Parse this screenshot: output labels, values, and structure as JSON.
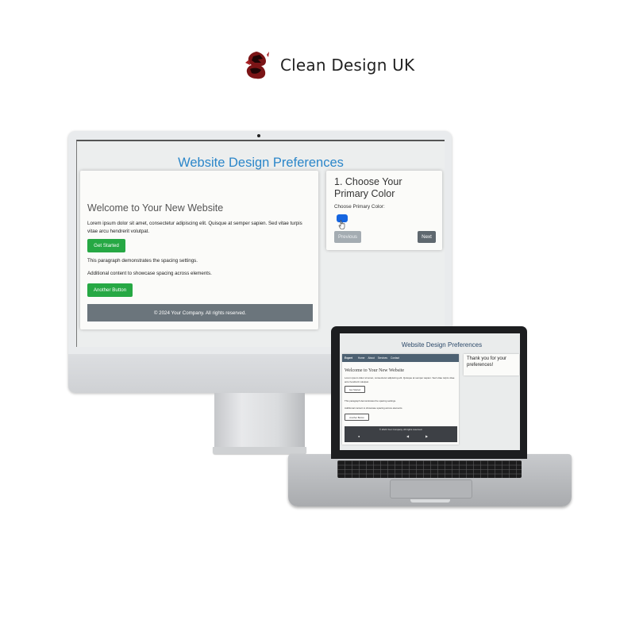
{
  "brand": {
    "name": "Clean Design UK",
    "logo_icon": "dragon-icon",
    "logo_color": "#7b1416"
  },
  "desktop": {
    "page_title": "Website Design Preferences",
    "title_color": "#2b86c9",
    "content": {
      "heading": "Welcome to Your New Website",
      "intro": "Lorem ipsum dolor sit amet, consectetur adipiscing elit. Quisque at semper sapien. Sed vitae turpis vitae arcu hendrerit volutpat.",
      "primary_button": "Get Started",
      "paragraph_2": "This paragraph demonstrates the spacing settings.",
      "paragraph_3": "Additional content to showcase spacing across elements.",
      "secondary_button": "Another Button",
      "footer": "© 2024 Your Company. All rights reserved.",
      "button_color": "#26a844"
    },
    "preferences": {
      "step_title": "1. Choose Your Primary Color",
      "field_label": "Choose Primary Color:",
      "selected_color": "#1565e0",
      "previous_button": "Previous",
      "next_button": "Next"
    }
  },
  "laptop": {
    "page_title": "Website Design Preferences",
    "nav": {
      "brand": "Expert",
      "items": [
        "Home",
        "About",
        "Services",
        "Contact"
      ]
    },
    "content": {
      "heading": "Welcome to Your New Website",
      "intro": "Lorem ipsum dolor sit amet, consectetur adipiscing elit. Quisque at semper sapien. Sed vitae turpis vitae arcu hendrerit volutpat.",
      "primary_button": "Get Started",
      "paragraph_2": "This paragraph demonstrates the spacing settings.",
      "paragraph_3": "Additional content to showcase spacing across elements.",
      "secondary_button": "Another Button",
      "footer": "© 2024 Your Company. All rights reserved.",
      "footer_icons": [
        "info-icon",
        "prev-icon",
        "next-icon"
      ]
    },
    "thanks_message": "Thank you for your preferences!"
  }
}
